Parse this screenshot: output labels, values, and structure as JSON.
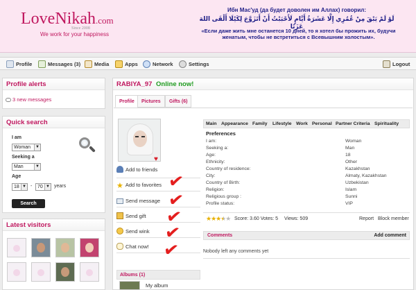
{
  "header": {
    "logo": "LoveNikah",
    "logo_domain": ".com",
    "since": "Since 2008",
    "tagline": "We work for your happiness",
    "quote_title": "Ибн Мас'уд (да будет доволен им Аллах) говорил:",
    "quote_arabic": "لَوْ لَمْ يَبْقَ مِنْ عُمُرِي إِلَّا عَشَرَةُ أَيَّامٍ لَأَحْبَبْتُ أَنْ أَتَزَوَّجَ لِكَيْلَا أَلْقَى اللهَ عَزَبًا",
    "quote_ru": "«Если даже жить мне останется 10 дней, то я хотел бы прожить их, будучи женатым, чтобы не встретиться с Всевышним холостым»."
  },
  "nav": {
    "profile": "Profile",
    "messages": "Messages (3)",
    "media": "Media",
    "apps": "Apps",
    "network": "Network",
    "settings": "Settings",
    "logout": "Logout"
  },
  "alerts": {
    "title": "Profile alerts",
    "link": "3 new messages"
  },
  "quick_search": {
    "title": "Quick search",
    "iam_label": "I am",
    "iam_value": "Woman",
    "seeking_label": "Seeking a",
    "seeking_value": "Man",
    "age_label": "Age",
    "age_from": "18",
    "age_sep": "-",
    "age_to": "70",
    "age_unit": "years",
    "button": "Search"
  },
  "visitors": {
    "title": "Latest visitors"
  },
  "profile": {
    "username": "RABIYA_97",
    "online": "Online now!",
    "tabs": [
      "Profile",
      "Pictures",
      "Gifts (6)"
    ],
    "actions": {
      "add_friends": "Add to friends",
      "add_favorites": "Add to favorites",
      "send_message": "Send message",
      "send_gift": "Send gift",
      "send_wink": "Send wink",
      "chat": "Chat now!"
    },
    "albums": "Albums (1)",
    "album_name": "My album"
  },
  "info": {
    "tabs": [
      "Main",
      "Appearance",
      "Family",
      "Lifestyle",
      "Work",
      "Personal",
      "Partner Criteria",
      "Spirituality"
    ],
    "section": "Preferences",
    "rows": [
      {
        "k": "I am:",
        "v": "Woman"
      },
      {
        "k": "Seeking a:",
        "v": "Man"
      },
      {
        "k": "Age:",
        "v": "18"
      },
      {
        "k": "Ethnicity:",
        "v": "Other"
      },
      {
        "k": "Country of residence:",
        "v": "Kazakhstan"
      },
      {
        "k": "City:",
        "v": "Almaty, Kazakhstan"
      },
      {
        "k": "Country of Birth:",
        "v": "Uzbekistan"
      },
      {
        "k": "Religion:",
        "v": "Islam"
      },
      {
        "k": "Religious group :",
        "v": "Sunni"
      },
      {
        "k": "Profile status:",
        "v": "VIP"
      }
    ],
    "rating": 3.6,
    "score_text": "Score: 3.60 Votes: 5",
    "views": "Views: 509",
    "report": "Report",
    "block": "Block member"
  },
  "comments": {
    "title": "Comments",
    "add": "Add comment",
    "empty": "Nobody left any comments yet"
  },
  "colors": {
    "brand": "#c0185f",
    "online": "#1e9a1e",
    "checkmark": "#e41e1e"
  }
}
